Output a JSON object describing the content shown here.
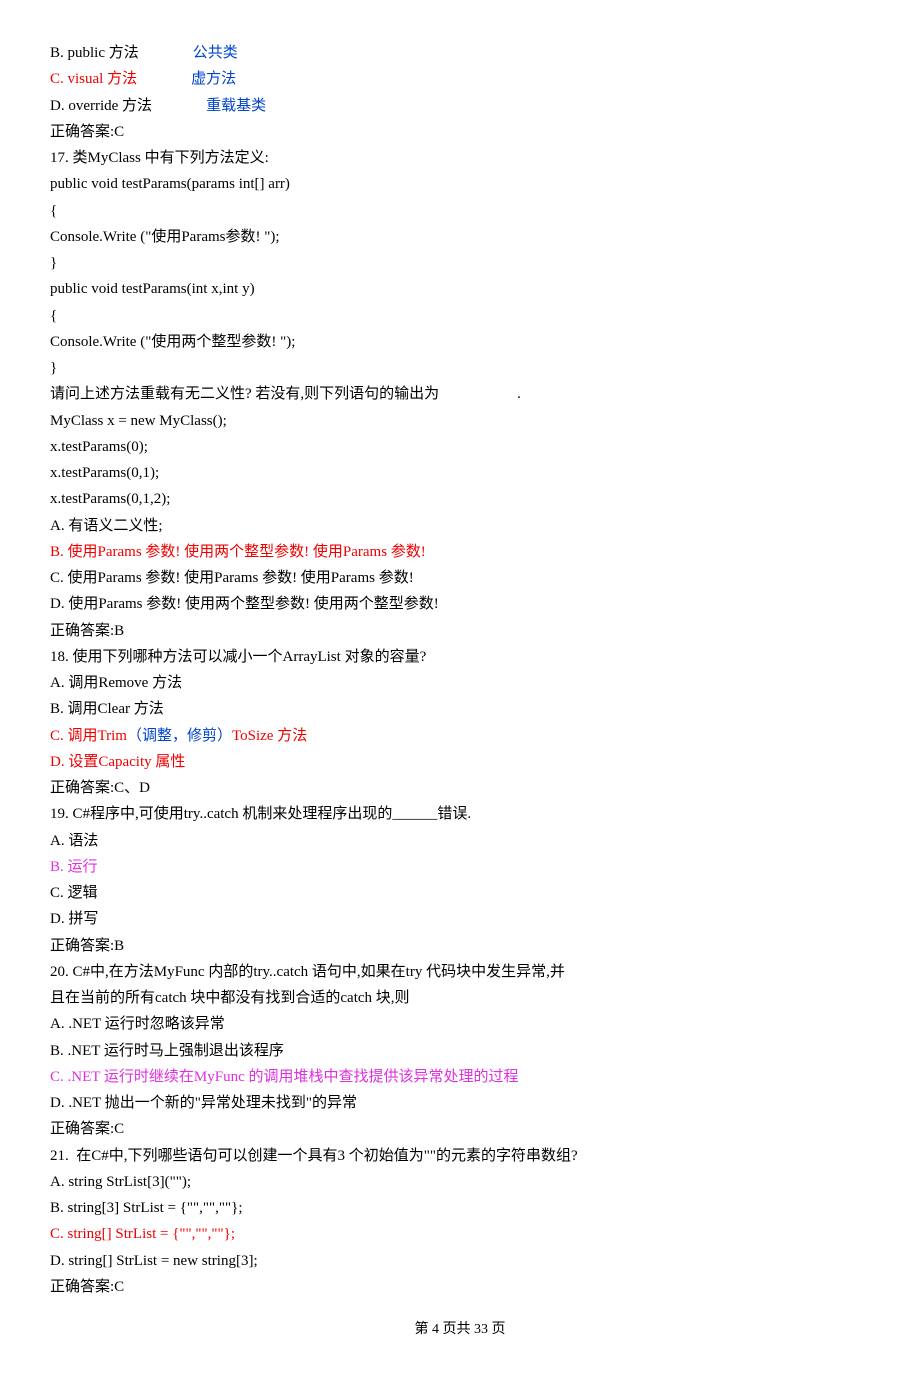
{
  "lines": [
    {
      "segments": [
        {
          "text": "B. public 方法"
        },
        {
          "cls": "gap",
          "text": ""
        },
        {
          "cls": "blue",
          "text": "公共类"
        }
      ]
    },
    {
      "segments": [
        {
          "cls": "red",
          "text": "C. visual 方法"
        },
        {
          "cls": "gap",
          "text": ""
        },
        {
          "cls": "blue",
          "text": "虚方法"
        }
      ]
    },
    {
      "segments": [
        {
          "text": "D. override 方法"
        },
        {
          "cls": "gap",
          "text": ""
        },
        {
          "cls": "blue",
          "text": "重载基类"
        }
      ]
    },
    {
      "segments": [
        {
          "text": "正确答案:C"
        }
      ]
    },
    {
      "segments": [
        {
          "text": "17. 类MyClass 中有下列方法定义:"
        }
      ]
    },
    {
      "segments": [
        {
          "text": "public void testParams(params int[] arr)"
        }
      ]
    },
    {
      "segments": [
        {
          "text": "{"
        }
      ]
    },
    {
      "segments": [
        {
          "text": "Console.Write (\"使用Params参数! \");"
        }
      ]
    },
    {
      "segments": [
        {
          "text": "}"
        }
      ]
    },
    {
      "segments": [
        {
          "text": "public void testParams(int x,int y)"
        }
      ]
    },
    {
      "segments": [
        {
          "text": "{"
        }
      ]
    },
    {
      "segments": [
        {
          "text": "Console.Write (\"使用两个整型参数! \");"
        }
      ]
    },
    {
      "segments": [
        {
          "text": "}"
        }
      ]
    },
    {
      "segments": [
        {
          "text": "请问上述方法重载有无二义性? 若没有,则下列语句的输出为"
        },
        {
          "cls": "ans-hint",
          "text": ""
        },
        {
          "text": "."
        }
      ]
    },
    {
      "segments": [
        {
          "text": "MyClass x = new MyClass();"
        }
      ]
    },
    {
      "segments": [
        {
          "text": "x.testParams(0);"
        }
      ]
    },
    {
      "segments": [
        {
          "text": "x.testParams(0,1);"
        }
      ]
    },
    {
      "segments": [
        {
          "text": "x.testParams(0,1,2);"
        }
      ]
    },
    {
      "segments": [
        {
          "text": "A. 有语义二义性;"
        }
      ]
    },
    {
      "segments": [
        {
          "cls": "red",
          "text": "B. 使用Params 参数! 使用两个整型参数! 使用Params 参数!"
        }
      ]
    },
    {
      "segments": [
        {
          "text": "C. 使用Params 参数! 使用Params 参数! 使用Params 参数!"
        }
      ]
    },
    {
      "segments": [
        {
          "text": "D. 使用Params 参数! 使用两个整型参数! 使用两个整型参数!"
        }
      ]
    },
    {
      "segments": [
        {
          "text": "正确答案:B"
        }
      ]
    },
    {
      "segments": [
        {
          "text": "18. 使用下列哪种方法可以减小一个ArrayList 对象的容量?"
        }
      ]
    },
    {
      "segments": [
        {
          "text": "A. 调用Remove 方法"
        }
      ]
    },
    {
      "segments": [
        {
          "text": "B. 调用Clear 方法"
        }
      ]
    },
    {
      "segments": [
        {
          "cls": "red",
          "text": "C. 调用Trim"
        },
        {
          "cls": "blue",
          "text": "（调整，修剪）"
        },
        {
          "cls": "red",
          "text": "ToSize 方法"
        }
      ]
    },
    {
      "segments": [
        {
          "cls": "red",
          "text": "D. 设置Capacity 属性"
        }
      ]
    },
    {
      "segments": [
        {
          "text": "正确答案:C、D"
        }
      ]
    },
    {
      "segments": [
        {
          "text": "19. C#程序中,可使用try..catch 机制来处理程序出现的______错误."
        }
      ]
    },
    {
      "segments": [
        {
          "text": "A. 语法"
        }
      ]
    },
    {
      "segments": [
        {
          "cls": "magenta",
          "text": "B. 运行"
        }
      ]
    },
    {
      "segments": [
        {
          "text": "C. 逻辑"
        }
      ]
    },
    {
      "segments": [
        {
          "text": "D. 拼写"
        }
      ]
    },
    {
      "segments": [
        {
          "text": "正确答案:B"
        }
      ]
    },
    {
      "segments": [
        {
          "text": "20. C#中,在方法MyFunc 内部的try..catch 语句中,如果在try 代码块中发生异常,并"
        }
      ]
    },
    {
      "segments": [
        {
          "text": "且在当前的所有catch 块中都没有找到合适的catch 块,则"
        }
      ]
    },
    {
      "segments": [
        {
          "text": "A. .NET 运行时忽略该异常"
        }
      ]
    },
    {
      "segments": [
        {
          "text": "B. .NET 运行时马上强制退出该程序"
        }
      ]
    },
    {
      "segments": [
        {
          "cls": "magenta",
          "text": "C. .NET 运行时继续在MyFunc 的调用堆栈中查找提供该异常处理的过程"
        }
      ]
    },
    {
      "segments": [
        {
          "text": "D. .NET 抛出一个新的\"异常处理未找到\"的异常"
        }
      ]
    },
    {
      "segments": [
        {
          "text": "正确答案:C"
        }
      ]
    },
    {
      "segments": [
        {
          "text": "21.  在C#中,下列哪些语句可以创建一个具有3 个初始值为\"\"的元素的字符串数组?"
        }
      ]
    },
    {
      "segments": [
        {
          "text": "A. string StrList[3](\"\");"
        }
      ]
    },
    {
      "segments": [
        {
          "text": "B. string[3] StrList = {\"\",\"\",\"\"};"
        }
      ]
    },
    {
      "segments": [
        {
          "cls": "red",
          "text": "C. string[] StrList = {\"\",\"\",\"\"};"
        }
      ]
    },
    {
      "segments": [
        {
          "text": "D. string[] StrList = new string[3];"
        }
      ]
    },
    {
      "segments": [
        {
          "text": "正确答案:C"
        }
      ]
    }
  ],
  "footer": "第 4 页共 33 页"
}
